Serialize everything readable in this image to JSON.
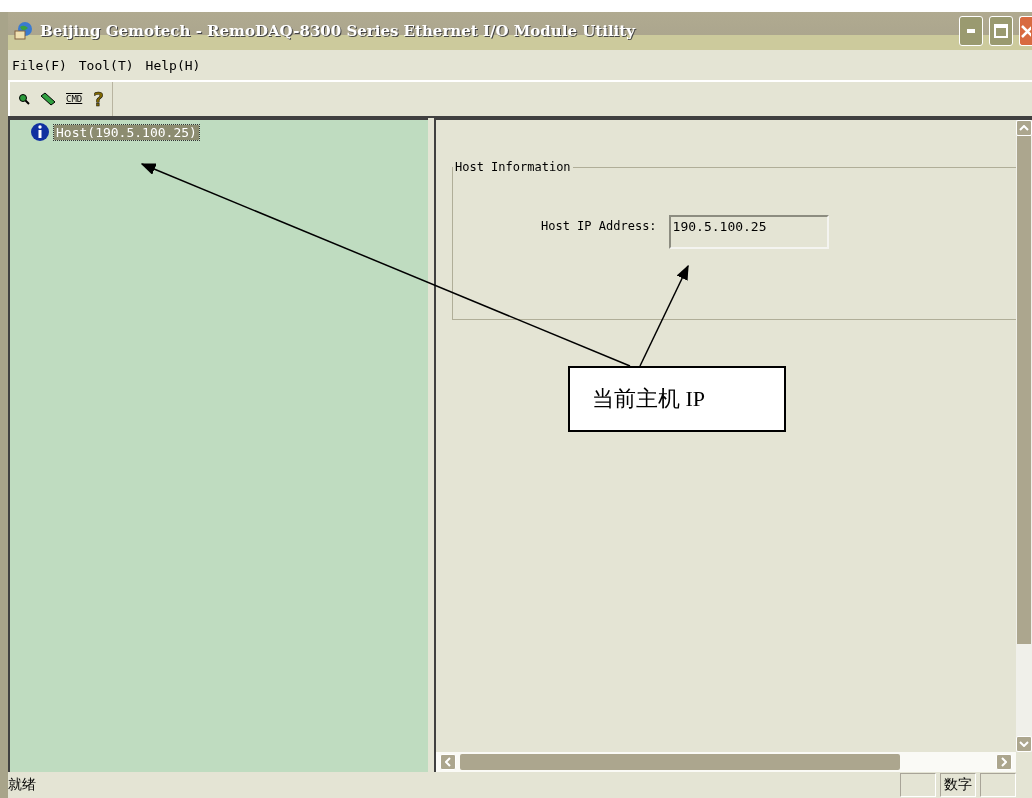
{
  "window": {
    "title": "Beijing Gemotech - RemoDAQ-8300 Series Ethernet I/O Module Utility"
  },
  "menu": [
    {
      "label": "File(F)"
    },
    {
      "label": "Tool(T)"
    },
    {
      "label": "Help(H)"
    }
  ],
  "toolbar": [
    {
      "kind": "search"
    },
    {
      "kind": "pen"
    },
    {
      "kind": "cmd",
      "label": "CMD"
    },
    {
      "kind": "help",
      "label": "?"
    }
  ],
  "tree": [
    {
      "label": "Host(190.5.100.25)",
      "selected": true
    }
  ],
  "host_information": {
    "title": "Host Information",
    "label": "Host IP Address:",
    "value": "190.5.100.25"
  },
  "callout": {
    "text": "当前主机 IP"
  },
  "status_bar": {
    "message": "就绪",
    "indicator": "数字"
  }
}
